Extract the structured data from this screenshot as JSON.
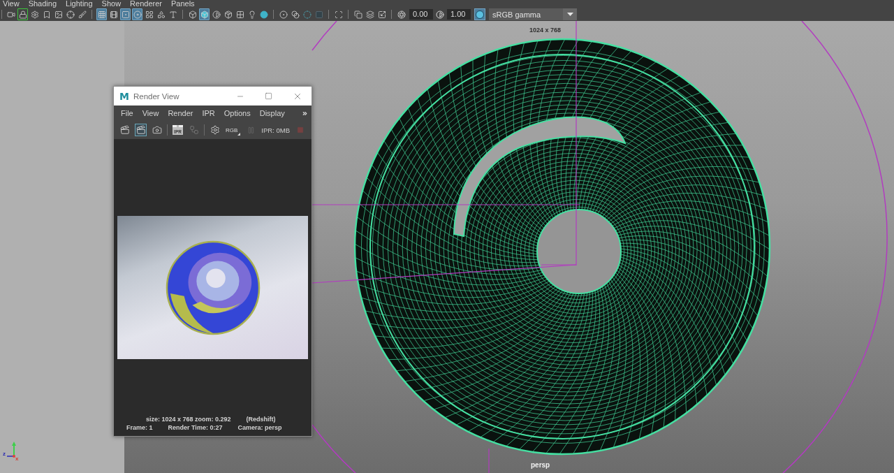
{
  "menu_bar": [
    {
      "label": "View"
    },
    {
      "label": "Shading"
    },
    {
      "label": "Lighting"
    },
    {
      "label": "Show"
    },
    {
      "label": "Renderer"
    },
    {
      "label": "Panels"
    }
  ],
  "toolbar": {
    "groups": [
      [
        {
          "kind": "camera",
          "selected": false
        },
        {
          "kind": "lockcamera",
          "selected": true
        },
        {
          "kind": "cameragear",
          "selected": false
        },
        {
          "kind": "bookmark",
          "selected": false
        },
        {
          "kind": "imageplane",
          "selected": false
        },
        {
          "kind": "crosshair",
          "selected": false
        },
        {
          "kind": "brush",
          "selected": false
        }
      ],
      [
        {
          "kind": "grid",
          "selected": true
        },
        {
          "kind": "film",
          "selected": false
        },
        {
          "kind": "resolution",
          "selected": true
        },
        {
          "kind": "mask",
          "selected": true
        },
        {
          "kind": "fieldchart",
          "selected": false
        },
        {
          "kind": "safeaction",
          "selected": false
        },
        {
          "kind": "titlesafe",
          "selected": false
        }
      ],
      [
        {
          "kind": "wireframe",
          "selected": false
        },
        {
          "kind": "shaded",
          "selected": true
        },
        {
          "kind": "smooth",
          "selected": false
        },
        {
          "kind": "texture",
          "selected": false
        },
        {
          "kind": "checker",
          "selected": false
        },
        {
          "kind": "bulb",
          "selected": false
        },
        {
          "kind": "shadow",
          "selected": false
        }
      ],
      [
        {
          "kind": "ambient",
          "selected": false
        },
        {
          "kind": "occlusion",
          "selected": false
        },
        {
          "kind": "ring",
          "selected": false
        },
        {
          "kind": "block",
          "selected": false
        }
      ],
      [
        {
          "kind": "isolate",
          "selected": false
        }
      ],
      [
        {
          "kind": "xray",
          "selected": false
        },
        {
          "kind": "layers",
          "selected": false
        },
        {
          "kind": "scale",
          "selected": false
        }
      ],
      [
        {
          "kind": "aperture",
          "selected": false
        }
      ]
    ],
    "exposure": "0.00",
    "gamma": "1.00",
    "color_management": {
      "on": true
    },
    "view_transform": "sRGB gamma"
  },
  "viewport": {
    "resolution_label": "1024 x 768",
    "camera_label": "persp",
    "axis": {
      "z_label": "z",
      "x_label": "x"
    }
  },
  "render_view": {
    "logo": "M",
    "title": "Render View",
    "menu": [
      {
        "label": "File"
      },
      {
        "label": "View"
      },
      {
        "label": "Render"
      },
      {
        "label": "IPR"
      },
      {
        "label": "Options"
      },
      {
        "label": "Display"
      }
    ],
    "toolbar": {
      "groups": [
        [
          {
            "kind": "render",
            "selected": false,
            "disabled": false
          },
          {
            "kind": "region",
            "selected": true,
            "disabled": false
          },
          {
            "kind": "snapshot",
            "selected": false,
            "disabled": false
          }
        ],
        [
          {
            "kind": "ipr",
            "label": "IPR",
            "selected": false,
            "disabled": false
          },
          {
            "kind": "refresh",
            "selected": false,
            "disabled": true
          }
        ],
        [
          {
            "kind": "settings",
            "selected": false,
            "disabled": false
          },
          {
            "kind": "channels",
            "label": "RGB",
            "selected": false,
            "disabled": false
          }
        ]
      ]
    },
    "ipr_bar": {
      "pause": {
        "disabled": true
      },
      "memory": "IPR: 0MB",
      "stop": {
        "disabled": true
      }
    },
    "status": {
      "size": "size: 1024 x 768 zoom: 0.292",
      "renderer": "(Redshift)",
      "frame": "Frame: 1",
      "render_time": "Render Time: 0:27",
      "camera": "Camera: persp"
    }
  }
}
